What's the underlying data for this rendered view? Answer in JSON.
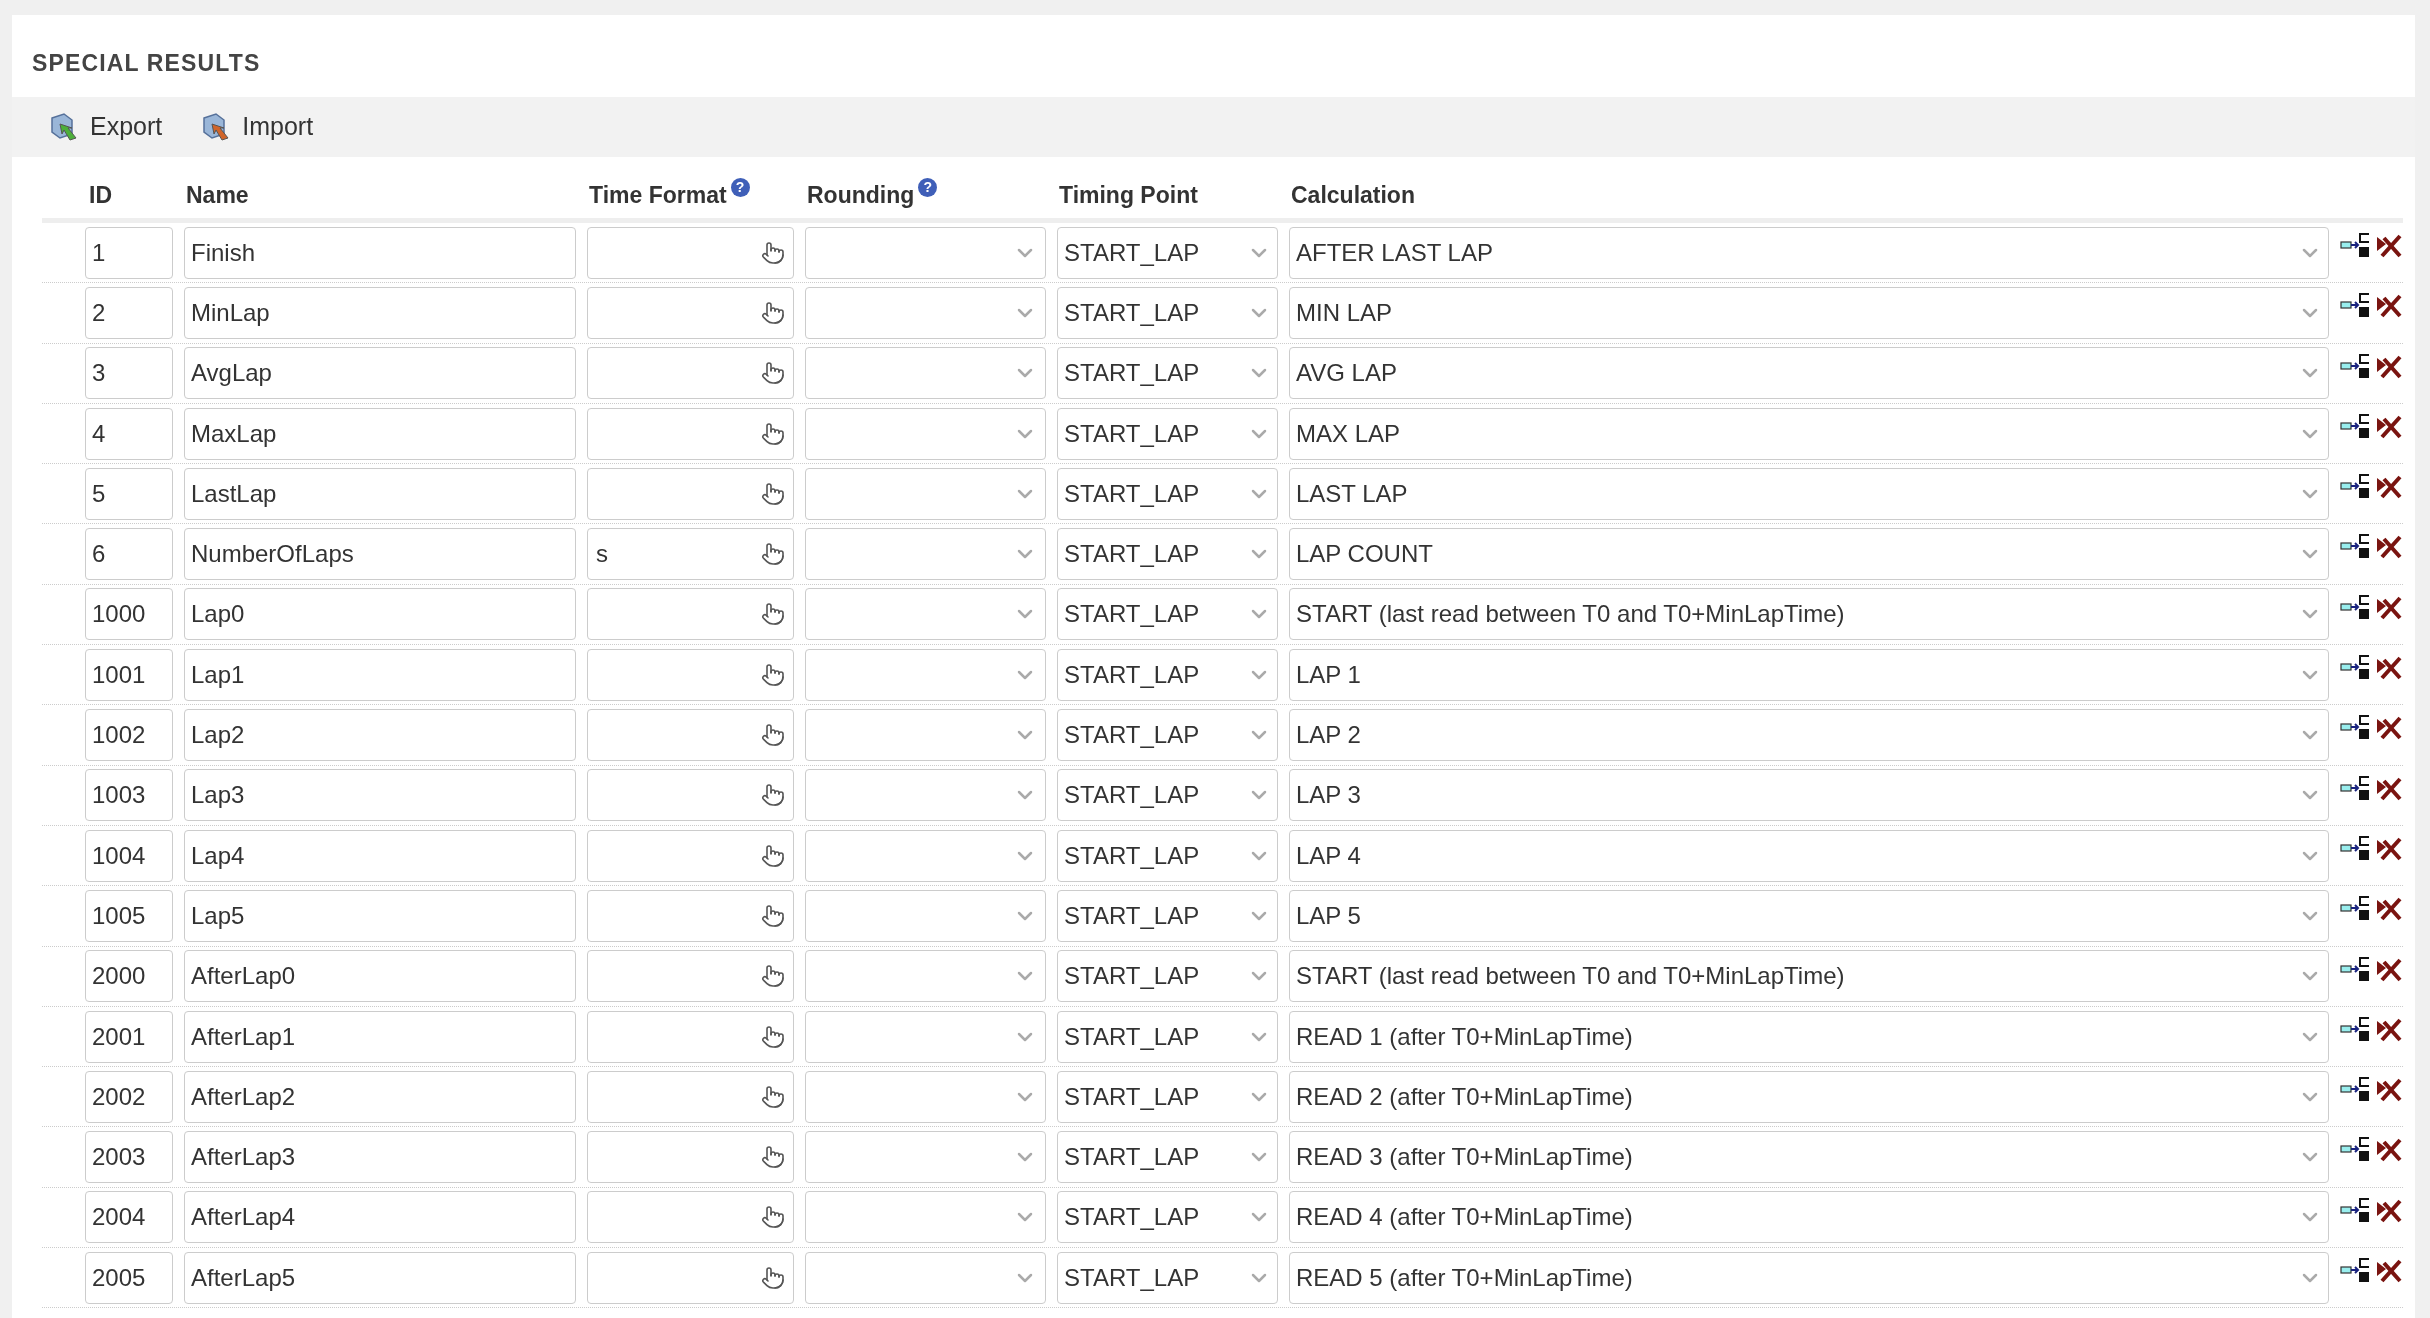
{
  "title": "SPECIAL RESULTS",
  "toolbar": [
    {
      "kind": "export",
      "label": "Export"
    },
    {
      "kind": "import",
      "label": "Import"
    }
  ],
  "columns": [
    {
      "label": "ID"
    },
    {
      "label": "Name"
    },
    {
      "label": "Time Format",
      "help": "?"
    },
    {
      "label": "Rounding",
      "help": "?"
    },
    {
      "label": "Timing Point"
    },
    {
      "label": "Calculation"
    }
  ],
  "rows": [
    {
      "id": "1",
      "name": "Finish",
      "timing_point": "START_LAP",
      "calculation": "AFTER LAST LAP"
    },
    {
      "id": "2",
      "name": "MinLap",
      "timing_point": "START_LAP",
      "calculation": "MIN LAP"
    },
    {
      "id": "3",
      "name": "AvgLap",
      "timing_point": "START_LAP",
      "calculation": "AVG LAP"
    },
    {
      "id": "4",
      "name": "MaxLap",
      "timing_point": "START_LAP",
      "calculation": "MAX LAP"
    },
    {
      "id": "5",
      "name": "LastLap",
      "timing_point": "START_LAP",
      "calculation": "LAST LAP"
    },
    {
      "id": "6",
      "name": "NumberOfLaps",
      "time_format": "s",
      "timing_point": "START_LAP",
      "calculation": "LAP COUNT"
    },
    {
      "id": "1000",
      "name": "Lap0",
      "timing_point": "START_LAP",
      "calculation": "START (last read between T0 and T0+MinLapTime)"
    },
    {
      "id": "1001",
      "name": "Lap1",
      "timing_point": "START_LAP",
      "calculation": "LAP 1"
    },
    {
      "id": "1002",
      "name": "Lap2",
      "timing_point": "START_LAP",
      "calculation": "LAP 2"
    },
    {
      "id": "1003",
      "name": "Lap3",
      "timing_point": "START_LAP",
      "calculation": "LAP 3"
    },
    {
      "id": "1004",
      "name": "Lap4",
      "timing_point": "START_LAP",
      "calculation": "LAP 4"
    },
    {
      "id": "1005",
      "name": "Lap5",
      "timing_point": "START_LAP",
      "calculation": "LAP 5"
    },
    {
      "id": "2000",
      "name": "AfterLap0",
      "timing_point": "START_LAP",
      "calculation": "START (last read between T0 and T0+MinLapTime)"
    },
    {
      "id": "2001",
      "name": "AfterLap1",
      "timing_point": "START_LAP",
      "calculation": "READ 1 (after T0+MinLapTime)"
    },
    {
      "id": "2002",
      "name": "AfterLap2",
      "timing_point": "START_LAP",
      "calculation": "READ 2 (after T0+MinLapTime)"
    },
    {
      "id": "2003",
      "name": "AfterLap3",
      "timing_point": "START_LAP",
      "calculation": "READ 3 (after T0+MinLapTime)"
    },
    {
      "id": "2004",
      "name": "AfterLap4",
      "timing_point": "START_LAP",
      "calculation": "READ 4 (after T0+MinLapTime)"
    },
    {
      "id": "2005",
      "name": "AfterLap5",
      "timing_point": "START_LAP",
      "calculation": "READ 5 (after T0+MinLapTime)"
    }
  ]
}
